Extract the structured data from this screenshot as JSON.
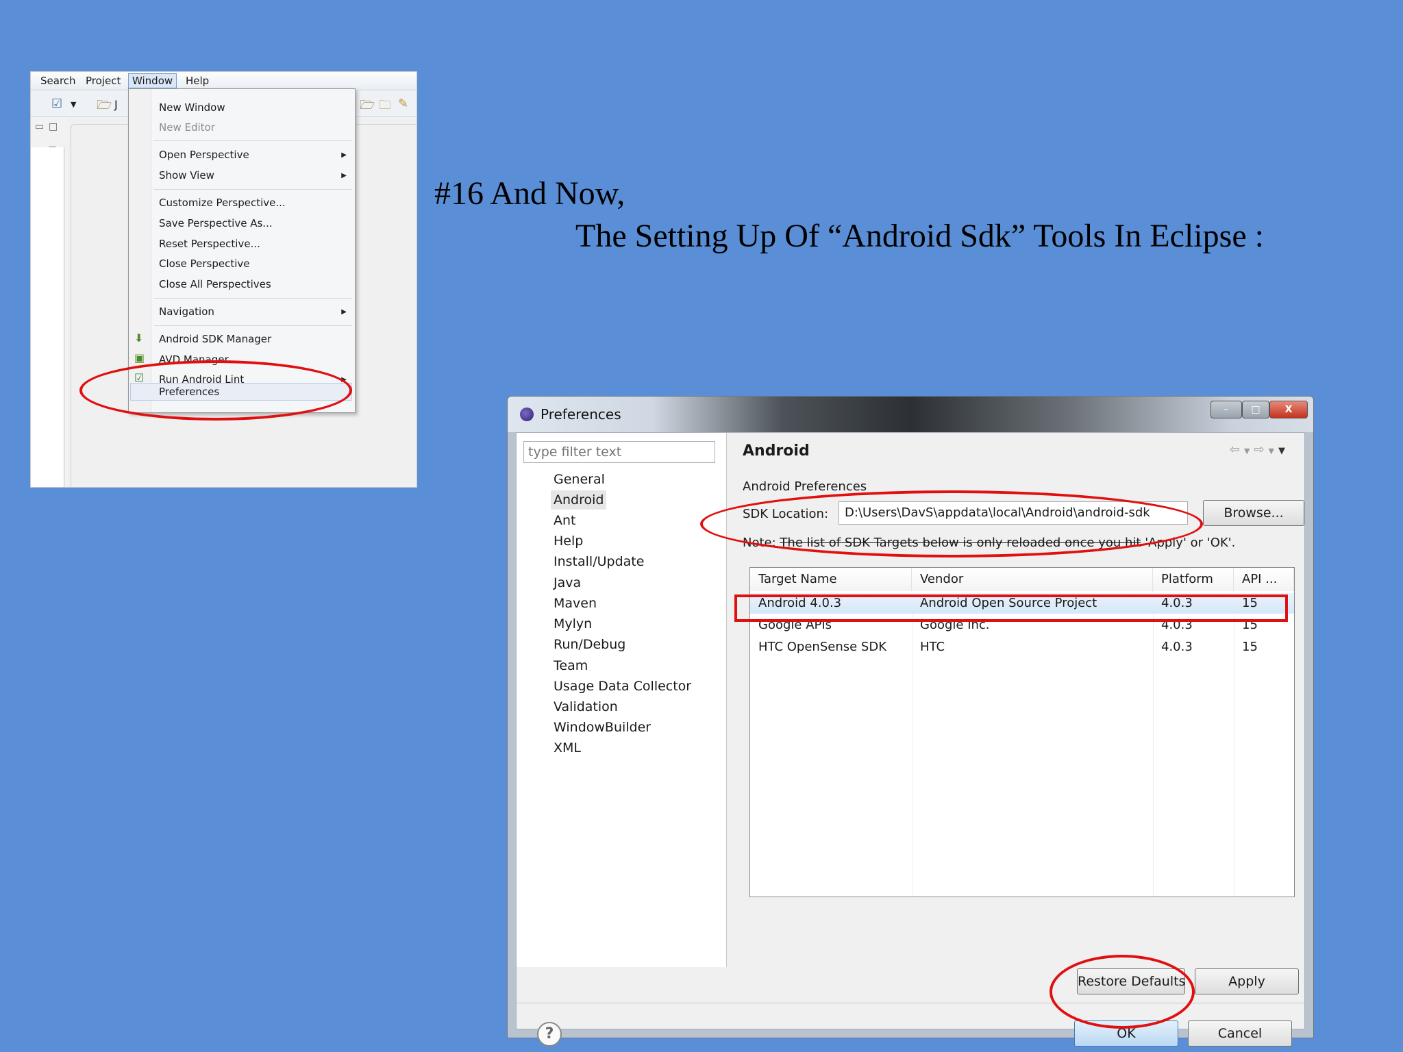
{
  "slide": {
    "title_line1": "#16 And Now,",
    "title_line2": "The Setting Up Of “Android Sdk” Tools In Eclipse :"
  },
  "eclipse_menu": {
    "menubar": [
      "Search",
      "Project",
      "Window",
      "Help"
    ],
    "items": [
      {
        "label": "New Window",
        "disabled": false
      },
      {
        "label": "New Editor",
        "disabled": true
      },
      {
        "label": "Open Perspective",
        "submenu": true
      },
      {
        "label": "Show View",
        "submenu": true
      },
      {
        "label": "Customize Perspective..."
      },
      {
        "label": "Save Perspective As..."
      },
      {
        "label": "Reset Perspective..."
      },
      {
        "label": "Close Perspective"
      },
      {
        "label": "Close All Perspectives"
      },
      {
        "label": "Navigation",
        "submenu": true
      },
      {
        "label": "Android SDK Manager",
        "icon": "android-sdk-icon"
      },
      {
        "label": "AVD Manager",
        "icon": "avd-icon"
      },
      {
        "label": "Run Android Lint",
        "icon": "check-icon",
        "submenu": true
      },
      {
        "label": "Preferences",
        "highlighted": true
      }
    ],
    "toolbar_partial_label": "J"
  },
  "preferences": {
    "window_title": "Preferences",
    "filter_placeholder": "type filter text",
    "nav": [
      "General",
      "Android",
      "Ant",
      "Help",
      "Install/Update",
      "Java",
      "Maven",
      "Mylyn",
      "Run/Debug",
      "Team",
      "Usage Data Collector",
      "Validation",
      "WindowBuilder",
      "XML"
    ],
    "selected_nav": "Android",
    "page_title": "Android",
    "section_label": "Android Preferences",
    "sdk_label": "SDK Location:",
    "sdk_value": "D:\\Users\\DavS\\appdata\\local\\Android\\android-sdk",
    "browse_label": "Browse...",
    "note_prefix": "Note:",
    "note_struck": "The list of SDK Targets below is only reloaded once you hit",
    "note_suffix": "'Apply' or 'OK'.",
    "table": {
      "headers": [
        "Target Name",
        "Vendor",
        "Platform",
        "API ..."
      ],
      "rows": [
        [
          "Android 4.0.3",
          "Android Open Source Project",
          "4.0.3",
          "15"
        ],
        [
          "Google APIs",
          "Google Inc.",
          "4.0.3",
          "15"
        ],
        [
          "HTC OpenSense SDK",
          "HTC",
          "4.0.3",
          "15"
        ]
      ]
    },
    "restore_defaults_label": "Restore Defaults",
    "apply_label": "Apply",
    "ok_label": "OK",
    "cancel_label": "Cancel",
    "help_glyph": "?",
    "titlebar_buttons": {
      "minimize": "–",
      "maximize": "□",
      "close": "X"
    }
  },
  "colors": {
    "slide_background": "#5a8ed6",
    "annotation_red": "#e01010"
  }
}
